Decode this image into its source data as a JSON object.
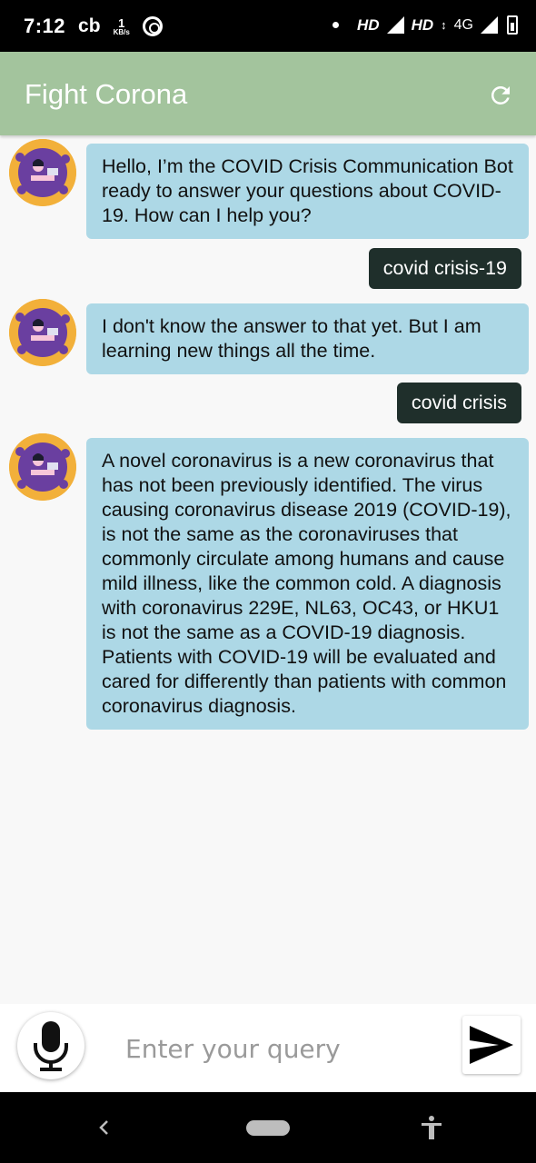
{
  "status_bar": {
    "time": "7:12",
    "carrier_icon": "cb",
    "speed_value": "1",
    "speed_unit": "KB/s",
    "hd1": "HD",
    "hd2": "HD",
    "network": "4G"
  },
  "app_bar": {
    "title": "Fight Corona",
    "refresh_icon": "refresh-icon"
  },
  "messages": [
    {
      "sender": "bot",
      "text": "Hello, I’m the COVID Crisis Communication Bot ready to answer your questions about COVID-19. How can I help you?"
    },
    {
      "sender": "user",
      "text": "covid crisis-19"
    },
    {
      "sender": "bot",
      "text": "I don't know the answer to that yet. But I am learning new things all the time."
    },
    {
      "sender": "user",
      "text": "covid crisis"
    },
    {
      "sender": "bot",
      "text": "A novel coronavirus is a new coronavirus that has not been previously identified. The virus causing coronavirus disease 2019 (COVID-19), is not the same as the coronaviruses that commonly circulate among humans and cause mild illness, like the common cold. A diagnosis with coronavirus 229E, NL63, OC43, or HKU1 is not the same as a COVID-19 diagnosis. Patients with COVID-19 will be evaluated and cared for differently than patients with common coronavirus diagnosis."
    }
  ],
  "input_bar": {
    "placeholder": "Enter your query",
    "mic_icon": "microphone-icon",
    "send_icon": "send-icon"
  },
  "colors": {
    "app_bar": "#a3c49d",
    "bot_bubble": "#add8e6",
    "user_bubble": "#1f2f2b"
  }
}
